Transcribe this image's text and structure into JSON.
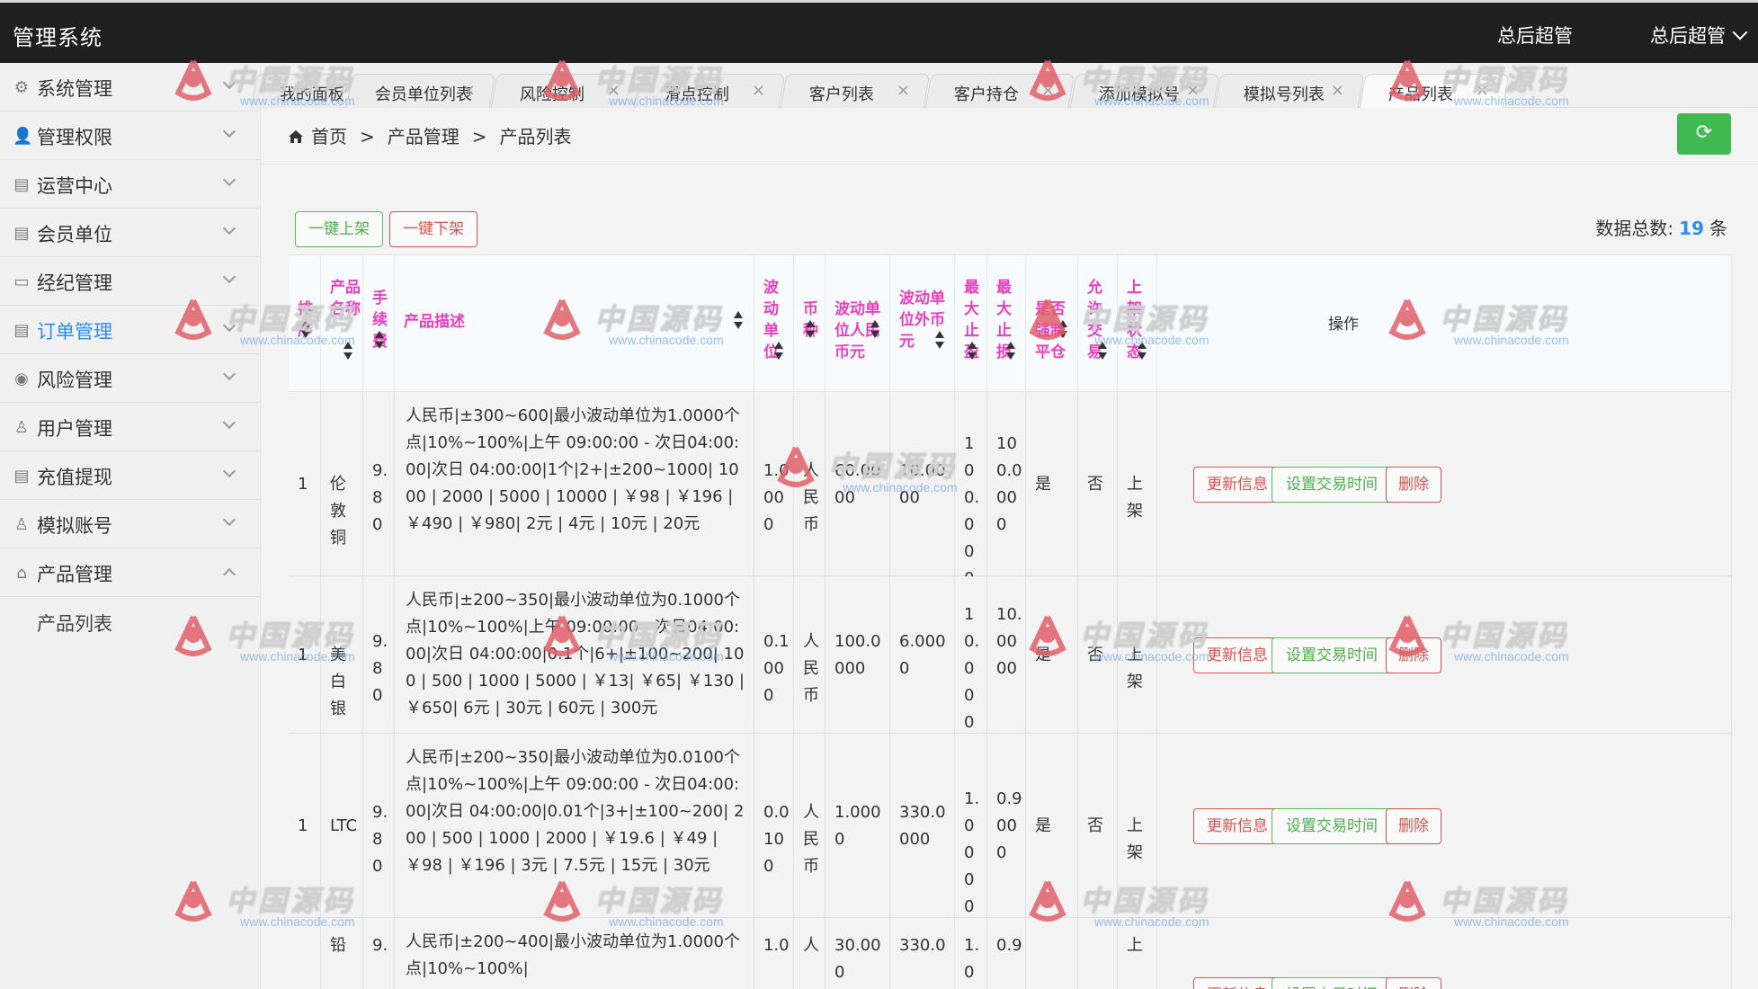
{
  "app": {
    "title": "管理系统",
    "user_role": "总后超管",
    "user_name": "总后超管"
  },
  "sidebar": {
    "items": [
      {
        "label": "系统管理",
        "icon": "gear-icon",
        "glyph": "⚙"
      },
      {
        "label": "管理权限",
        "icon": "user-icon",
        "glyph": "👤"
      },
      {
        "label": "运营中心",
        "icon": "building-icon",
        "glyph": "▤"
      },
      {
        "label": "会员单位",
        "icon": "list-icon",
        "glyph": "▤"
      },
      {
        "label": "经纪管理",
        "icon": "card-icon",
        "glyph": "▭"
      },
      {
        "label": "订单管理",
        "icon": "order-icon",
        "glyph": "▤"
      },
      {
        "label": "风险管理",
        "icon": "shield-icon",
        "glyph": "◉"
      },
      {
        "label": "用户管理",
        "icon": "user-outline-icon",
        "glyph": "♙"
      },
      {
        "label": "充值提现",
        "icon": "wallet-icon",
        "glyph": "▤"
      },
      {
        "label": "模拟账号",
        "icon": "user-outline-icon",
        "glyph": "♙"
      },
      {
        "label": "产品管理",
        "icon": "bag-icon",
        "glyph": "⌂"
      }
    ],
    "sub_items": [
      {
        "label": "产品列表"
      }
    ]
  },
  "tabs": [
    {
      "label": "我的面板"
    },
    {
      "label": "会员单位列表"
    },
    {
      "label": "风险控制"
    },
    {
      "label": "滑点控制"
    },
    {
      "label": "客户列表"
    },
    {
      "label": "客户持仓"
    },
    {
      "label": "添加模拟号"
    },
    {
      "label": "模拟号列表"
    },
    {
      "label": "产品列表"
    }
  ],
  "tab_close_glyph": "×",
  "breadcrumb": {
    "home": "首页",
    "sep": ">",
    "level1": "产品管理",
    "level2": "产品列表"
  },
  "refresh_glyph": "⟳",
  "toolbar": {
    "list_on": "一键上架",
    "list_off": "一键下架",
    "total_label": "数据总数:",
    "total_count": "19",
    "total_unit": "条"
  },
  "table": {
    "headers": {
      "sort": "排序",
      "name": "产品名称",
      "fee": "手续费",
      "desc": "产品描述",
      "unit": "波动单位",
      "currency": "币种",
      "unit_rmb": "波动单位人民币元",
      "unit_fx": "波动单位外币元",
      "max_profit": "最大止盈",
      "max_loss": "最大止损",
      "force": "是否强制平仓",
      "allow": "允许交易",
      "status": "上架状态",
      "ops": "操作"
    },
    "ops": {
      "update": "更新信息",
      "time": "设置交易时间",
      "delete": "删除"
    },
    "rows": [
      {
        "sort": "1",
        "name": "伦敦铜",
        "fee": "9.80",
        "desc": "人民币|±300~600|最小波动单位为1.0000个点|10%~100%|上午 09:00:00 - 次日04:00:00|次日 04:00:00|1个|2+|±200~1000| 1000 | 2000 | 5000 | 10000 | ￥98 | ￥196 | ￥490 | ￥980| 2元 | 4元 | 10元 | 20元",
        "unit": "1.0000",
        "currency": "人民币",
        "unit_rmb": "60.0000",
        "unit_fx": "10.0000",
        "max_profit": "100.0000",
        "max_loss": "100.0000",
        "force": "是",
        "allow": "否",
        "status": "上架"
      },
      {
        "sort": "1",
        "name": "美白银",
        "fee": "9.80",
        "desc": "人民币|±200~350|最小波动单位为0.1000个点|10%~100%|上午 09:00:00 - 次日04:00:00|次日 04:00:00|0.1个|6+|±100~200| 100 | 500 | 1000 | 5000 | ￥13| ￥65| ￥130 | ￥650| 6元 | 30元 | 60元 | 300元",
        "unit": "0.1000",
        "currency": "人民币",
        "unit_rmb": "100.0000",
        "unit_fx": "6.0000",
        "max_profit": "10.0000",
        "max_loss": "10.0000",
        "force": "是",
        "allow": "否",
        "status": "上架"
      },
      {
        "sort": "1",
        "name": "LTC",
        "fee": "9.80",
        "desc": "人民币|±200~350|最小波动单位为0.0100个点|10%~100%|上午 09:00:00 - 次日04:00:00|次日 04:00:00|0.01个|3+|±100~200| 200 | 500 | 1000 | 2000 | ￥19.6 | ￥49 | ￥98 | ￥196 | 3元 | 7.5元 | 15元 | 30元",
        "unit": "0.0100",
        "currency": "人民币",
        "unit_rmb": "1.0000",
        "unit_fx": "330.0000",
        "max_profit": "1.0000",
        "max_loss": "0.9000",
        "force": "是",
        "allow": "否",
        "status": "上架"
      },
      {
        "sort": "",
        "name": "铅",
        "fee": "9.",
        "desc": "人民币|±200~400|最小波动单位为1.0000个点|10%~100%|",
        "unit": "1.0",
        "currency": "人",
        "unit_rmb": "30.000",
        "unit_fx": "330.0",
        "max_profit": "1.0",
        "max_loss": "0.9",
        "force": "",
        "allow": "",
        "status": "上"
      }
    ]
  },
  "watermark": {
    "text": "中国源码",
    "url": "www.chinacode.com",
    "color": "#e0606a"
  },
  "colors": {
    "accent": "#2d8cf0",
    "header_text": "#e83fbf",
    "success": "#3fb950",
    "danger": "#d9534f"
  }
}
